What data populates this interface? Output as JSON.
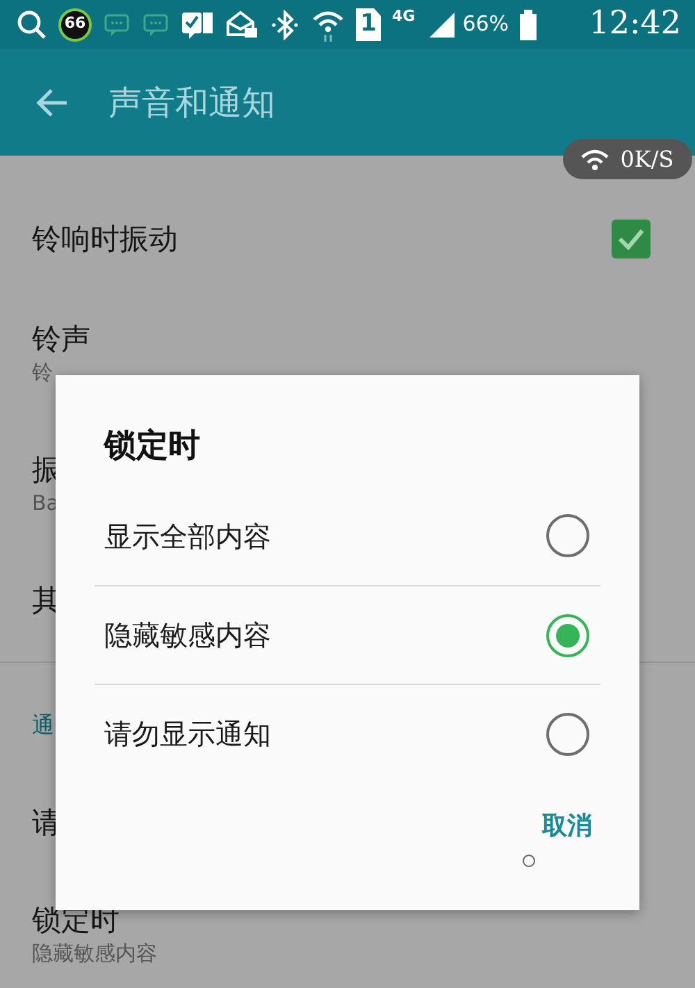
{
  "status_bar": {
    "notification_badge": "66",
    "sim_slot": "1",
    "network_type": "4G",
    "battery": "66%",
    "time": "12:42"
  },
  "app_bar": {
    "title": "声音和通知"
  },
  "network_speed": "0K/S",
  "settings": [
    {
      "kind": "toggle",
      "title": "铃响时振动",
      "checked": true
    },
    {
      "kind": "item",
      "title": "铃声",
      "subtitle": "铃"
    },
    {
      "kind": "item",
      "title": "振",
      "subtitle": "Ba"
    },
    {
      "kind": "item",
      "title": "其"
    },
    {
      "kind": "header",
      "title": "通"
    },
    {
      "kind": "item",
      "title": "请"
    },
    {
      "kind": "item",
      "title": "锁定时",
      "subtitle": "隐藏敏感内容"
    }
  ],
  "dialog": {
    "title": "锁定时",
    "options": [
      {
        "label": "显示全部内容",
        "selected": false
      },
      {
        "label": "隐藏敏感内容",
        "selected": true
      },
      {
        "label": "请勿显示通知",
        "selected": false
      }
    ],
    "buttons": [
      "取消"
    ]
  }
}
